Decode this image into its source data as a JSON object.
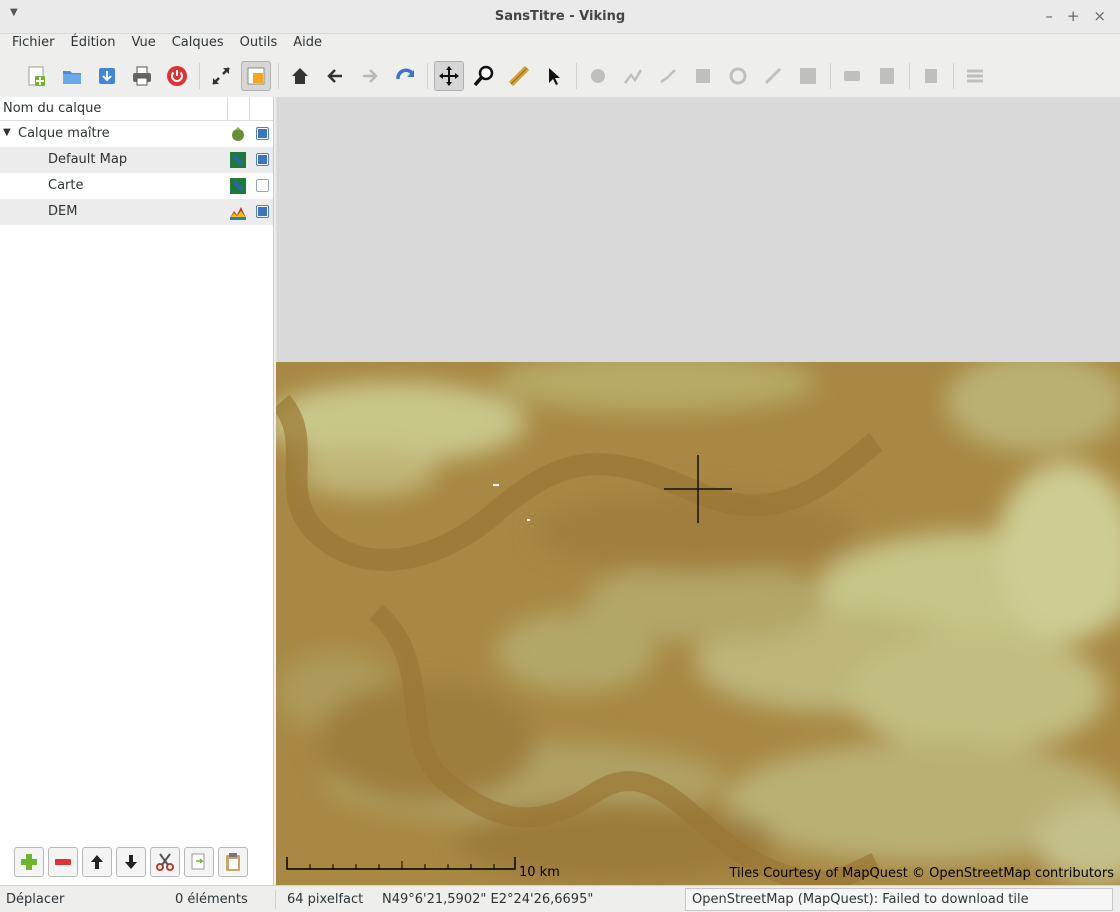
{
  "window": {
    "title": "SansTitre - Viking",
    "controls": [
      "–",
      "+",
      "×"
    ]
  },
  "menu": [
    "Fichier",
    "Édition",
    "Vue",
    "Calques",
    "Outils",
    "Aide"
  ],
  "layers": {
    "header": "Nom du calque",
    "items": [
      {
        "name": "Calque maître",
        "icon": "aggregate-layer-icon",
        "visible": true
      },
      {
        "name": "Default Map",
        "icon": "map-layer-icon",
        "visible": true
      },
      {
        "name": "Carte",
        "icon": "map-layer-icon",
        "visible": false
      },
      {
        "name": "DEM",
        "icon": "dem-layer-icon",
        "visible": true
      }
    ]
  },
  "map": {
    "scale_label": "10 km",
    "attribution": "Tiles Courtesy of MapQuest © OpenStreetMap contributors"
  },
  "status": {
    "tool": "Déplacer",
    "items": "0 éléments",
    "zoom": "64 pixelfact",
    "position": "N49°6'21,5902\" E2°24'26,6695\"",
    "message": "OpenStreetMap (MapQuest): Failed to download tile"
  },
  "colors": {
    "accent": "#3a74c4",
    "terrain_dark": "#9c7b38",
    "terrain_light": "#b8b370"
  }
}
